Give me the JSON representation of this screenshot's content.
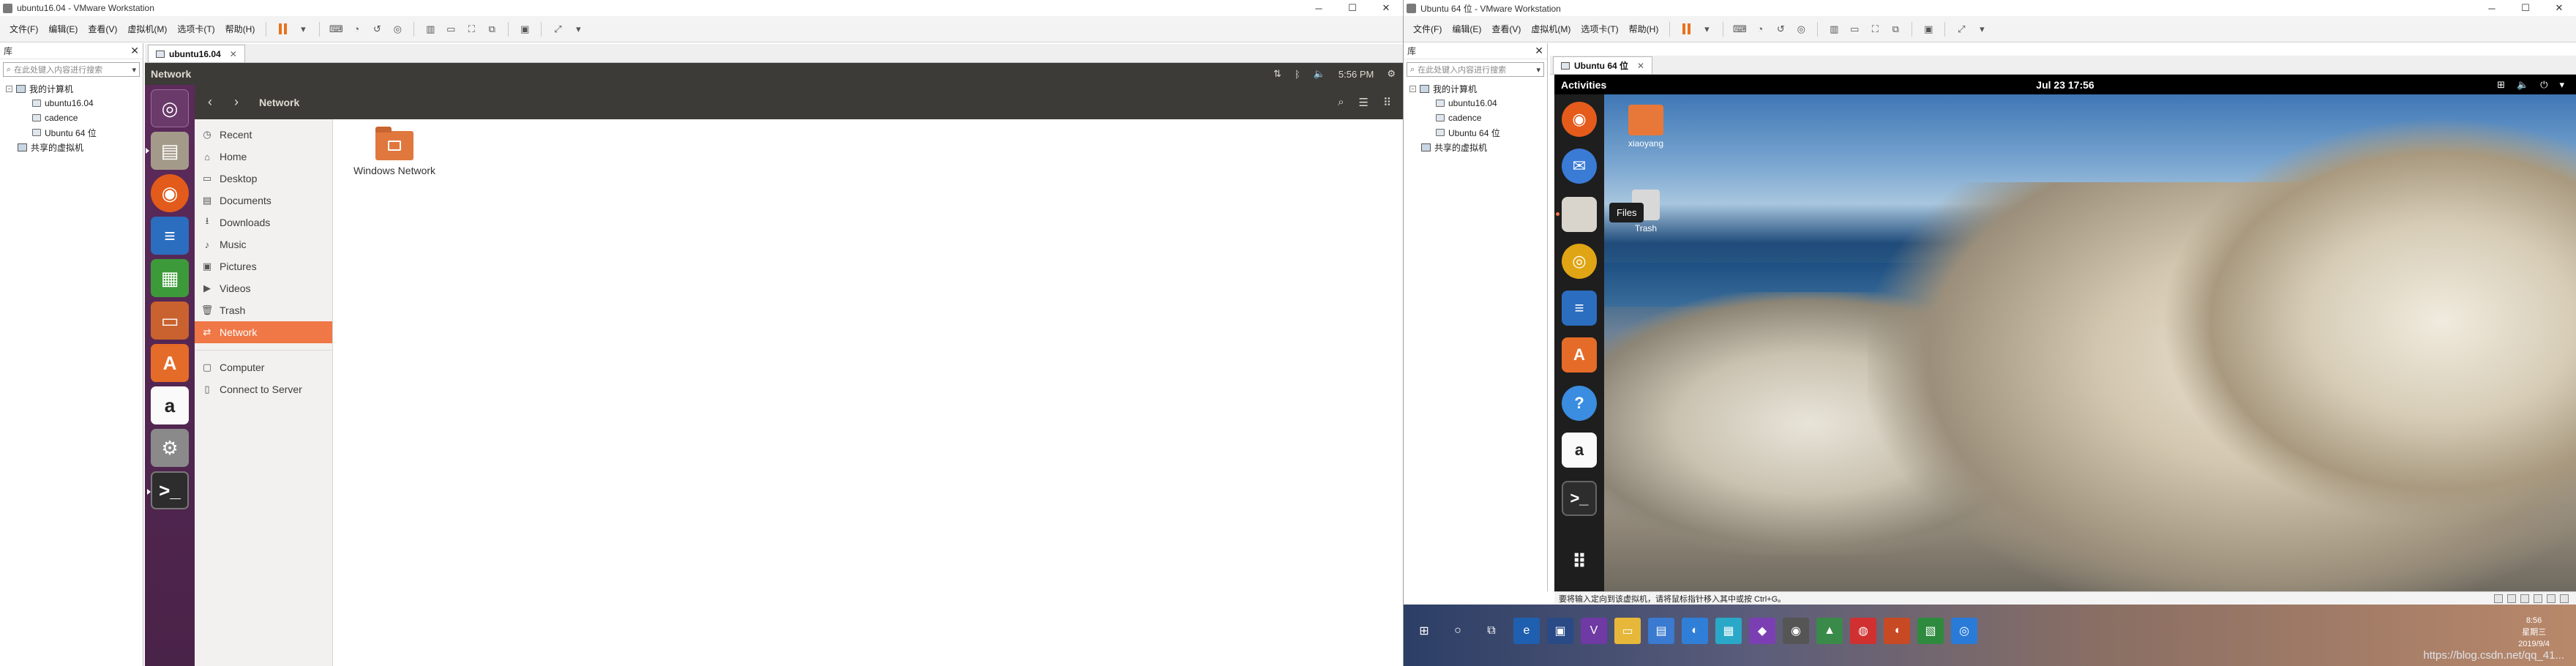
{
  "window1": {
    "title": "ubuntu16.04 - VMware Workstation",
    "menus": [
      "文件(F)",
      "编辑(E)",
      "查看(V)",
      "虚拟机(M)",
      "选项卡(T)",
      "帮助(H)"
    ],
    "library": {
      "header": "库",
      "search_placeholder": "在此处键入内容进行搜索",
      "tree": {
        "root": "我的计算机",
        "vms": [
          "ubuntu16.04",
          "cadence",
          "Ubuntu 64 位"
        ],
        "shared": "共享的虚拟机"
      }
    },
    "tab": {
      "label": "ubuntu16.04"
    },
    "ubuntu": {
      "top_panel_title": "Network",
      "time": "5:56 PM",
      "launcher": [
        "ubuntu-dash-icon",
        "files-icon",
        "firefox-icon",
        "writer-icon",
        "calc-icon",
        "impress-icon",
        "software-center-icon",
        "amazon-icon",
        "system-settings-icon",
        "terminal-icon"
      ],
      "location": "Network",
      "sidebar": {
        "items": [
          {
            "label": "Recent",
            "icon": "clock-icon"
          },
          {
            "label": "Home",
            "icon": "home-icon"
          },
          {
            "label": "Desktop",
            "icon": "folder-icon"
          },
          {
            "label": "Documents",
            "icon": "document-icon"
          },
          {
            "label": "Downloads",
            "icon": "download-icon"
          },
          {
            "label": "Music",
            "icon": "music-icon"
          },
          {
            "label": "Pictures",
            "icon": "pictures-icon"
          },
          {
            "label": "Videos",
            "icon": "videos-icon"
          },
          {
            "label": "Trash",
            "icon": "trash-icon"
          },
          {
            "label": "Network",
            "icon": "network-icon",
            "active": true
          }
        ],
        "other": [
          {
            "label": "Computer",
            "icon": "computer-icon"
          },
          {
            "label": "Connect to Server",
            "icon": "server-icon"
          }
        ]
      },
      "files": [
        {
          "label": "Windows Network",
          "icon": "windows-network-folder-icon"
        }
      ]
    }
  },
  "window2": {
    "title": "Ubuntu 64 位 - VMware Workstation",
    "menus": [
      "文件(F)",
      "编辑(E)",
      "查看(V)",
      "虚拟机(M)",
      "选项卡(T)",
      "帮助(H)"
    ],
    "library": {
      "header": "库",
      "search_placeholder": "在此处键入内容进行搜索",
      "tree": {
        "root": "我的计算机",
        "vms": [
          "ubuntu16.04",
          "cadence",
          "Ubuntu 64 位"
        ],
        "shared": "共享的虚拟机"
      }
    },
    "tab": {
      "label": "Ubuntu 64 位"
    },
    "gnome": {
      "activities": "Activities",
      "clock": "Jul 23  17:56",
      "dock": [
        "firefox-icon",
        "thunderbird-icon",
        "files-icon",
        "rhythmbox-icon",
        "writer-icon",
        "software-icon",
        "help-icon",
        "amazon-icon",
        "terminal-icon",
        "show-apps-icon"
      ],
      "tooltip": "Files",
      "desktop_icons": [
        {
          "label": "xiaoyang"
        },
        {
          "label": "Trash"
        }
      ]
    },
    "status": "要将输入定向到该虚拟机，请将鼠标指针移入其中或按 Ctrl+G。"
  },
  "taskbar": {
    "clock_time": "8:56",
    "clock_day": "星期三",
    "clock_date": "2019/9/4",
    "watermark": "https://blog.csdn.net/qq_41..."
  },
  "colors": {
    "ubuntu_orange": "#f07746",
    "unity_launcher": "#5c2a5b",
    "panel": "#3c3b37",
    "vmware_pause": "#e8731c"
  }
}
